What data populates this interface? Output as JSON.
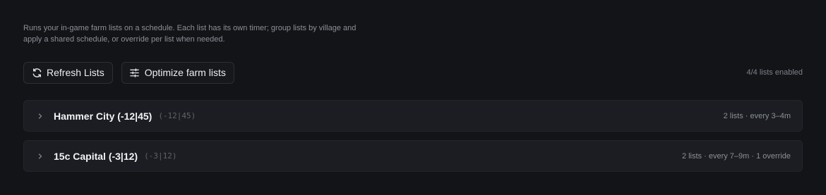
{
  "description": "Runs your in-game farm lists on a schedule. Each list has its own timer; group lists by village and apply a shared schedule, or override per list when needed.",
  "toolbar": {
    "refresh_label": "Refresh Lists",
    "refresh_icon": "refresh-icon",
    "optimize_label": "Optimize farm lists",
    "optimize_icon": "sliders-icon",
    "status": "4/4 lists enabled"
  },
  "groups": [
    {
      "name": "Hammer City (-12|45)",
      "coords": "(-12|45)",
      "summary": "2 lists · every 3–4m",
      "expanded": false
    },
    {
      "name": "15c Capital (-3|12)",
      "coords": "(-3|12)",
      "summary": "2 lists · every 7–9m · 1 override",
      "expanded": false
    }
  ],
  "colors": {
    "background": "#131417",
    "card": "#1b1d22",
    "border": "#2c2f36",
    "text": "#eceef1",
    "muted": "#8b8f98"
  }
}
